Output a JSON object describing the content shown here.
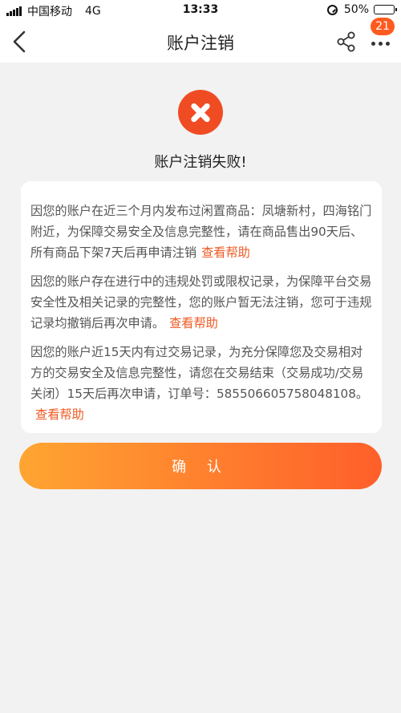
{
  "status_bar": {
    "carrier": "中国移动",
    "network": "4G",
    "time": "13:33",
    "battery_percent": "50%",
    "battery_level": 0.5
  },
  "nav": {
    "title": "账户注销",
    "back_icon": "chevron-left-icon",
    "share_icon": "share-icon",
    "more_icon": "more-dots-icon",
    "badge_count": "21"
  },
  "result": {
    "icon": "close-circle-icon",
    "icon_color": "#f04c24",
    "title": "账户注销失败!"
  },
  "reasons": [
    {
      "text": "因您的账户在近三个月内发布过闲置商品：凤塘新村，四海铭门附近，为保障交易安全及信息完整性，请在商品售出90天后、所有商品下架7天后再申请注销",
      "help": "查看帮助"
    },
    {
      "text": "因您的账户存在进行中的违规处罚或限权记录，为保障平台交易安全性及相关记录的完整性，您的账户暂无法注销，您可于违规记录均撤销后再次申请。",
      "help": "查看帮助"
    },
    {
      "text": "因您的账户近15天内有过交易记录，为充分保障您及交易相对方的交易安全及信息完整性，请您在交易结束（交易成功/交易关闭）15天后再次申请，订单号：585506605758048108。",
      "help": "查看帮助"
    }
  ],
  "confirm": {
    "label": "确 认"
  },
  "colors": {
    "accent": "#ef5a23",
    "button_gradient_start": "#ffa531",
    "button_gradient_end": "#ff5f2a",
    "background": "#f2f2f2"
  }
}
